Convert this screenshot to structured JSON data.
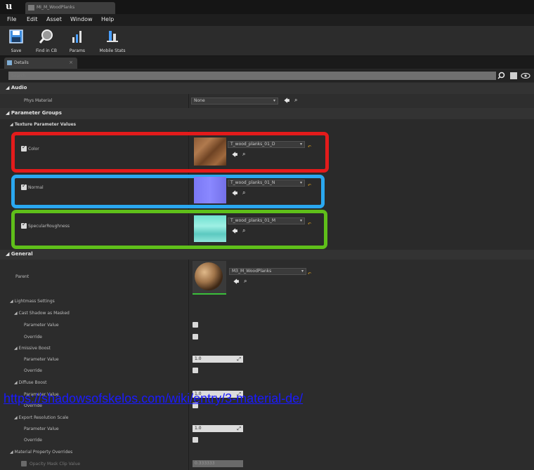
{
  "title_bar": {
    "app_logo": "u",
    "document_tab": "MI_M_WoodPlanks"
  },
  "menu": [
    "File",
    "Edit",
    "Asset",
    "Window",
    "Help"
  ],
  "toolbar": {
    "buttons": [
      {
        "label": "Save",
        "icon": "save-icon"
      },
      {
        "label": "Find in CB",
        "icon": "find-in-content-browser-icon"
      },
      {
        "label": "Params",
        "icon": "params-icon"
      },
      {
        "label": "Mobile Stats",
        "icon": "mobile-stats-icon"
      }
    ]
  },
  "details_panel": {
    "tab_label": "Details",
    "search_placeholder": "Search"
  },
  "sections": {
    "audio": {
      "header": "Audio",
      "phys_material_label": "Phys Material",
      "phys_material_value": "None"
    },
    "parameter_groups": {
      "header": "Parameter Groups",
      "texture_values_header": "Texture Parameter Values",
      "textures": [
        {
          "label": "Color",
          "value": "T_wood_planks_01_D",
          "checked": true,
          "highlight": "#e31b1b"
        },
        {
          "label": "Normal",
          "value": "T_wood_planks_01_N",
          "checked": true,
          "highlight": "#2aa8f0"
        },
        {
          "label": "SpecularRoughness",
          "value": "T_wood_planks_01_M",
          "checked": true,
          "highlight": "#5fbf1a"
        }
      ]
    },
    "general": {
      "header": "General",
      "parent_label": "Parent",
      "parent_value": "M3_M_WoodPlanks",
      "lightmass_header": "Lightmass Settings",
      "cast_shadow_header": "Cast Shadow as Masked",
      "parameter_value_label": "Parameter Value",
      "override_label": "Override",
      "emissive_boost_header": "Emissive Boost",
      "emissive_value": "1.0",
      "diffuse_boost_header": "Diffuse Boost",
      "export_res_header": "Export Resolution Scale",
      "export_value": "1.0",
      "material_overrides_header": "Material Property Overrides",
      "opacity_mask_label": "Opacity Mask Clip Value",
      "opacity_mask_value": "0.333333"
    }
  },
  "watermark": "https://shadowsofskelos.com/wiki/entry/3-material-de/"
}
